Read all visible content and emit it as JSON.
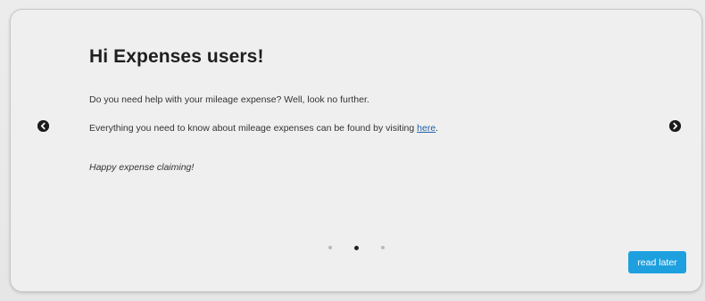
{
  "modal": {
    "title": "Hi Expenses users!",
    "paragraph1": "Do you need help with your mileage expense? Well, look no further.",
    "paragraph2_prefix": "Everything you need to know about mileage expenses can be found by visiting ",
    "paragraph2_link": "here",
    "paragraph2_suffix": ".",
    "paragraph3": "Happy expense claiming!",
    "read_later_label": "read later"
  },
  "carousel": {
    "prev_icon": "chevron-left-circle-icon",
    "next_icon": "chevron-right-circle-icon",
    "page_count": 3,
    "active_page": 2
  },
  "colors": {
    "accent": "#1ea0df",
    "link": "#1f5fa8",
    "modal_bg": "#efefef",
    "dot_active": "#222222",
    "dot_inactive": "#b9b9b9"
  }
}
